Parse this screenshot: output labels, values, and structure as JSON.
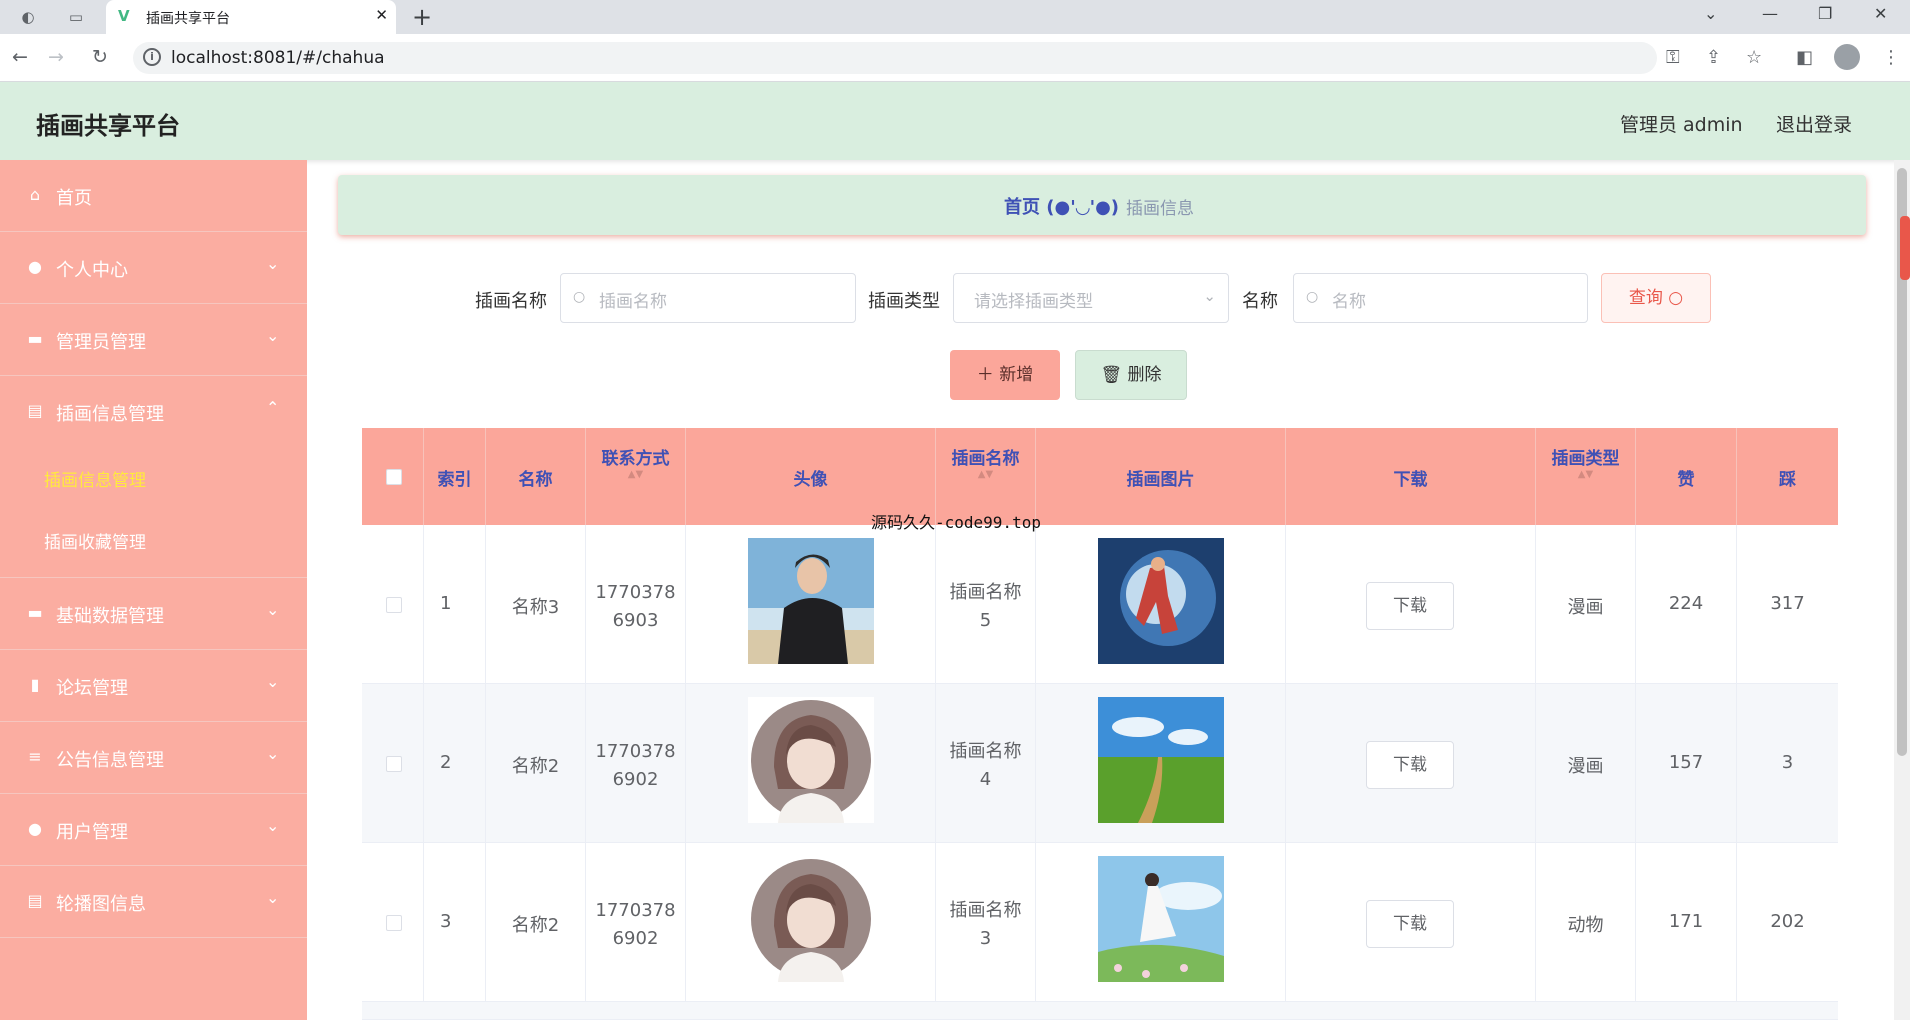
{
  "browser": {
    "tab_title": "插画共享平台",
    "url": "localhost:8081/#/chahua"
  },
  "header": {
    "brand": "插画共享平台",
    "user": "管理员 admin",
    "logout": "退出登录"
  },
  "sidebar": {
    "items": [
      {
        "label": "首页",
        "icon": "home-icon"
      },
      {
        "label": "个人中心",
        "icon": "user-icon"
      },
      {
        "label": "管理员管理",
        "icon": "folder-icon"
      },
      {
        "label": "插画信息管理",
        "icon": "clipboard-icon"
      },
      {
        "label": "基础数据管理",
        "icon": "folder-icon"
      },
      {
        "label": "论坛管理",
        "icon": "chart-icon"
      },
      {
        "label": "公告信息管理",
        "icon": "list-icon"
      },
      {
        "label": "用户管理",
        "icon": "user-icon"
      },
      {
        "label": "轮播图信息",
        "icon": "clipboard-icon"
      }
    ],
    "subitems": [
      {
        "label": "插画信息管理",
        "active": true
      },
      {
        "label": "插画收藏管理",
        "active": false
      }
    ],
    "active_color": "#ffeb3b"
  },
  "breadcrumb": {
    "home": "首页",
    "emoticon": "(●'◡'●)",
    "current": "插画信息"
  },
  "filters": {
    "name_label": "插画名称",
    "name_placeholder": "插画名称",
    "type_label": "插画类型",
    "type_placeholder": "请选择插画类型",
    "title_label": "名称",
    "title_placeholder": "名称",
    "query_label": "查询"
  },
  "actions": {
    "add_label": "新增",
    "delete_label": "删除"
  },
  "watermark_note": "源码久久-code99.top",
  "table": {
    "columns": [
      {
        "line1": "索引",
        "line2": ""
      },
      {
        "line1": "名称",
        "line2": ""
      },
      {
        "line1": "联系方式",
        "line2": ""
      },
      {
        "line1": "头像",
        "line2": ""
      },
      {
        "line1": "插画名称",
        "line2": ""
      },
      {
        "line1": "插画图片",
        "line2": ""
      },
      {
        "line1": "下载",
        "line2": ""
      },
      {
        "line1": "插画类型",
        "line2": ""
      },
      {
        "line1": "赞",
        "line2": ""
      },
      {
        "line1": "踩",
        "line2": ""
      }
    ],
    "download_label": "下载",
    "rows": [
      {
        "index": "1",
        "name": "名称3",
        "phone1": "1770378",
        "phone2": "6903",
        "avatar": "photo-man",
        "cname1": "插画名称",
        "cname2": "5",
        "image": "hero",
        "type": "漫画",
        "likes": "224",
        "dislikes": "317"
      },
      {
        "index": "2",
        "name": "名称2",
        "phone1": "1770378",
        "phone2": "6902",
        "avatar": "girl-illustration",
        "cname1": "插画名称",
        "cname2": "4",
        "image": "field",
        "type": "漫画",
        "likes": "157",
        "dislikes": "3"
      },
      {
        "index": "3",
        "name": "名称2",
        "phone1": "1770378",
        "phone2": "6902",
        "avatar": "girl-illustration",
        "cname1": "插画名称",
        "cname2": "3",
        "image": "woman-meadow",
        "type": "动物",
        "likes": "171",
        "dislikes": "202"
      }
    ]
  }
}
